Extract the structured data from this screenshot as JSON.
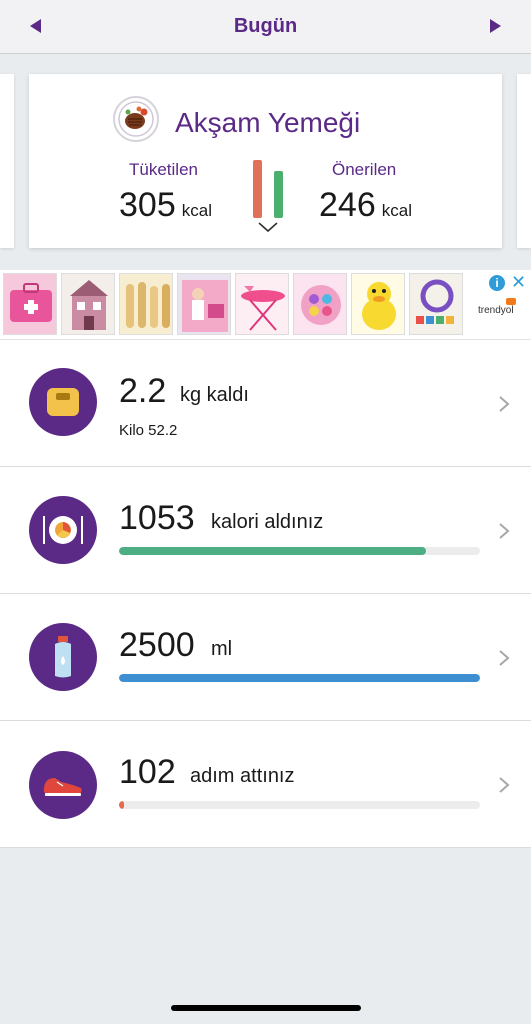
{
  "header": {
    "title": "Bugün"
  },
  "meal": {
    "title": "Akşam Yemeği",
    "consumed_label": "Tüketilen",
    "consumed_value": "305",
    "recommended_label": "Önerilen",
    "recommended_value": "246",
    "unit": "kcal"
  },
  "ad": {
    "brand": "trendyol",
    "info_glyph": "i",
    "close_glyph": "✕"
  },
  "trackers": {
    "weight": {
      "value": "2.2",
      "unit": "kg kaldı",
      "sub": "Kilo 52.2"
    },
    "calories": {
      "value": "1053",
      "unit": "kalori aldınız",
      "progress": 0.85,
      "color": "#4cae82"
    },
    "water": {
      "value": "2500",
      "unit": "ml",
      "progress": 1.0,
      "color": "#3d8fd1"
    },
    "steps": {
      "value": "102",
      "unit": "adım attınız",
      "progress": 0.015,
      "color": "#e46a4f"
    }
  },
  "colors": {
    "accent": "#5b2a86",
    "consumed_bar": "#e07059",
    "recommended_bar": "#4caf6e"
  }
}
